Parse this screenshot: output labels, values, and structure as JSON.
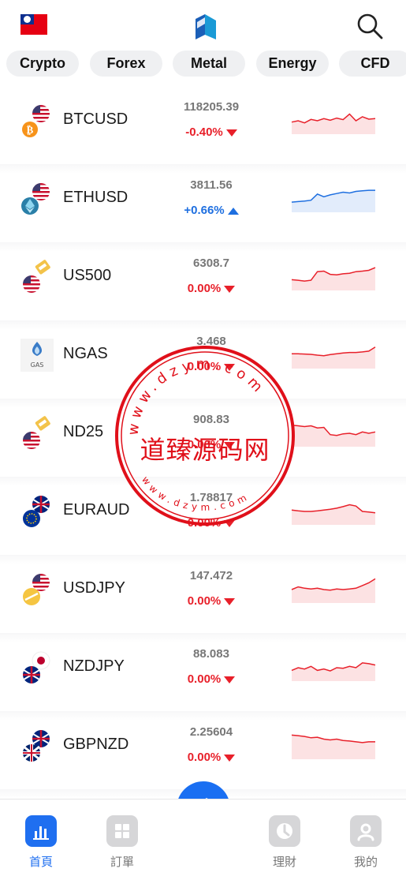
{
  "header": {
    "flag_icon": "taiwan-flag-icon",
    "logo_icon": "app-logo-icon",
    "search_icon": "search-icon"
  },
  "tabs": [
    {
      "label": "Crypto"
    },
    {
      "label": "Forex"
    },
    {
      "label": "Metal"
    },
    {
      "label": "Energy"
    },
    {
      "label": "CFD"
    }
  ],
  "colors": {
    "down": "#e8202a",
    "up": "#1e6fe0",
    "accent": "#1f6ff0"
  },
  "quotes": [
    {
      "symbol": "BTCUSD",
      "price": "118205.39",
      "change": "-0.40%",
      "direction": "down",
      "icon": "btc-usd-icon",
      "spark": [
        0.55,
        0.5,
        0.58,
        0.45,
        0.5,
        0.42,
        0.48,
        0.4,
        0.46,
        0.25,
        0.5,
        0.35,
        0.44,
        0.42
      ]
    },
    {
      "symbol": "ETHUSD",
      "price": "3811.56",
      "change": "+0.66%",
      "direction": "up",
      "icon": "eth-usd-icon",
      "spark": [
        0.62,
        0.6,
        0.58,
        0.55,
        0.32,
        0.42,
        0.35,
        0.3,
        0.25,
        0.28,
        0.22,
        0.2,
        0.18,
        0.18
      ]
    },
    {
      "symbol": "US500",
      "price": "6308.7",
      "change": "0.00%",
      "direction": "down",
      "icon": "us500-icon",
      "spark": [
        0.6,
        0.62,
        0.65,
        0.62,
        0.3,
        0.28,
        0.4,
        0.42,
        0.38,
        0.36,
        0.3,
        0.28,
        0.25,
        0.15
      ]
    },
    {
      "symbol": "NGAS",
      "price": "3.468",
      "change": "0.00%",
      "direction": "down",
      "icon": "natural-gas-icon",
      "spark": [
        0.45,
        0.45,
        0.46,
        0.47,
        0.5,
        0.52,
        0.48,
        0.45,
        0.42,
        0.4,
        0.4,
        0.38,
        0.35,
        0.2
      ]
    },
    {
      "symbol": "ND25",
      "price": "908.83",
      "change": "0.00%",
      "direction": "down",
      "icon": "nd25-icon",
      "spark": [
        0.2,
        0.22,
        0.25,
        0.22,
        0.3,
        0.28,
        0.55,
        0.58,
        0.52,
        0.5,
        0.55,
        0.45,
        0.5,
        0.45
      ]
    },
    {
      "symbol": "EURAUD",
      "price": "1.78817",
      "change": "0.00%",
      "direction": "down",
      "icon": "eur-aud-icon",
      "spark": [
        0.45,
        0.48,
        0.5,
        0.5,
        0.48,
        0.45,
        0.42,
        0.38,
        0.32,
        0.25,
        0.3,
        0.5,
        0.52,
        0.55
      ]
    },
    {
      "symbol": "USDJPY",
      "price": "147.472",
      "change": "0.00%",
      "direction": "down",
      "icon": "usd-jpy-icon",
      "spark": [
        0.5,
        0.4,
        0.45,
        0.48,
        0.45,
        0.5,
        0.52,
        0.48,
        0.5,
        0.48,
        0.45,
        0.35,
        0.25,
        0.1
      ]
    },
    {
      "symbol": "NZDJPY",
      "price": "88.083",
      "change": "0.00%",
      "direction": "down",
      "icon": "nzd-jpy-icon",
      "spark": [
        0.6,
        0.5,
        0.55,
        0.45,
        0.6,
        0.55,
        0.62,
        0.5,
        0.52,
        0.45,
        0.5,
        0.32,
        0.35,
        0.4
      ]
    },
    {
      "symbol": "GBPNZD",
      "price": "2.25604",
      "change": "0.00%",
      "direction": "down",
      "icon": "gbp-nzd-icon",
      "spark": [
        0.1,
        0.12,
        0.15,
        0.2,
        0.18,
        0.25,
        0.28,
        0.25,
        0.3,
        0.32,
        0.35,
        0.38,
        0.35,
        0.35
      ]
    }
  ],
  "overlay": {
    "partial_price": "0.00%",
    "partial_change": "0.00%"
  },
  "watermark": {
    "title": "道臻源码网",
    "ring_top": "www.dzym.com",
    "ring_bottom": "www.dzym.com"
  },
  "bottom_nav": [
    {
      "label": "首頁",
      "icon": "bar-chart-icon",
      "active": true
    },
    {
      "label": "訂單",
      "icon": "grid-icon",
      "active": false
    },
    {
      "label": "",
      "icon": "swap-icon",
      "active": false
    },
    {
      "label": "理財",
      "icon": "clock-icon",
      "active": false
    },
    {
      "label": "我的",
      "icon": "user-icon",
      "active": false
    }
  ]
}
